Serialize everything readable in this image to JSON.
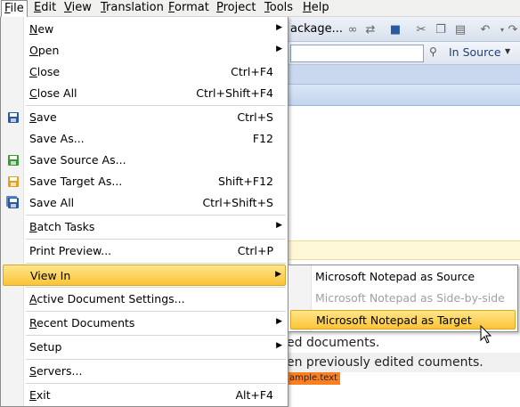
{
  "menubar": {
    "items": [
      "File",
      "Edit",
      "View",
      "Translation",
      "Format",
      "Project",
      "Tools",
      "Help"
    ]
  },
  "toolbar": {
    "package_label": "ackage..."
  },
  "searchbar": {
    "in_source_label": "In Source"
  },
  "file_menu": {
    "items": [
      {
        "label": "New",
        "shortcut": "",
        "submenu": true
      },
      {
        "label": "Open",
        "shortcut": "",
        "submenu": true
      },
      {
        "label": "Close",
        "shortcut": "Ctrl+F4"
      },
      {
        "label": "Close All",
        "shortcut": "Ctrl+Shift+F4"
      },
      {
        "label": "Save",
        "shortcut": "Ctrl+S",
        "icon": "save-icon"
      },
      {
        "label": "Save As...",
        "shortcut": "F12"
      },
      {
        "label": "Save Source As...",
        "shortcut": "",
        "icon": "save-source-icon"
      },
      {
        "label": "Save Target As...",
        "shortcut": "Shift+F12",
        "icon": "save-target-icon"
      },
      {
        "label": "Save All",
        "shortcut": "Ctrl+Shift+S",
        "icon": "save-all-icon"
      },
      {
        "label": "Batch Tasks",
        "shortcut": "",
        "submenu": true
      },
      {
        "label": "Print Preview...",
        "shortcut": "Ctrl+P"
      },
      {
        "label": "View In",
        "shortcut": "",
        "submenu": true,
        "highlighted": true
      },
      {
        "label": "Active Document Settings...",
        "shortcut": ""
      },
      {
        "label": "Recent Documents",
        "shortcut": "",
        "submenu": true
      },
      {
        "label": "Setup",
        "shortcut": "",
        "submenu": true
      },
      {
        "label": "Servers...",
        "shortcut": ""
      },
      {
        "label": "Exit",
        "shortcut": "Alt+F4"
      }
    ]
  },
  "view_in_submenu": {
    "items": [
      {
        "label": "Microsoft Notepad as Source",
        "enabled": true
      },
      {
        "label": "Microsoft Notepad as Side-by-side",
        "enabled": false
      },
      {
        "label": "Microsoft Notepad as Target",
        "enabled": true,
        "highlighted": true
      }
    ]
  },
  "background": {
    "line1": "ed documents.",
    "line2": "en previously edited couments.",
    "tag": "ample.text"
  },
  "colors": {
    "highlight_top": "#ffe58a",
    "highlight_bottom": "#fbc437",
    "tag": "#ff7f1e"
  }
}
